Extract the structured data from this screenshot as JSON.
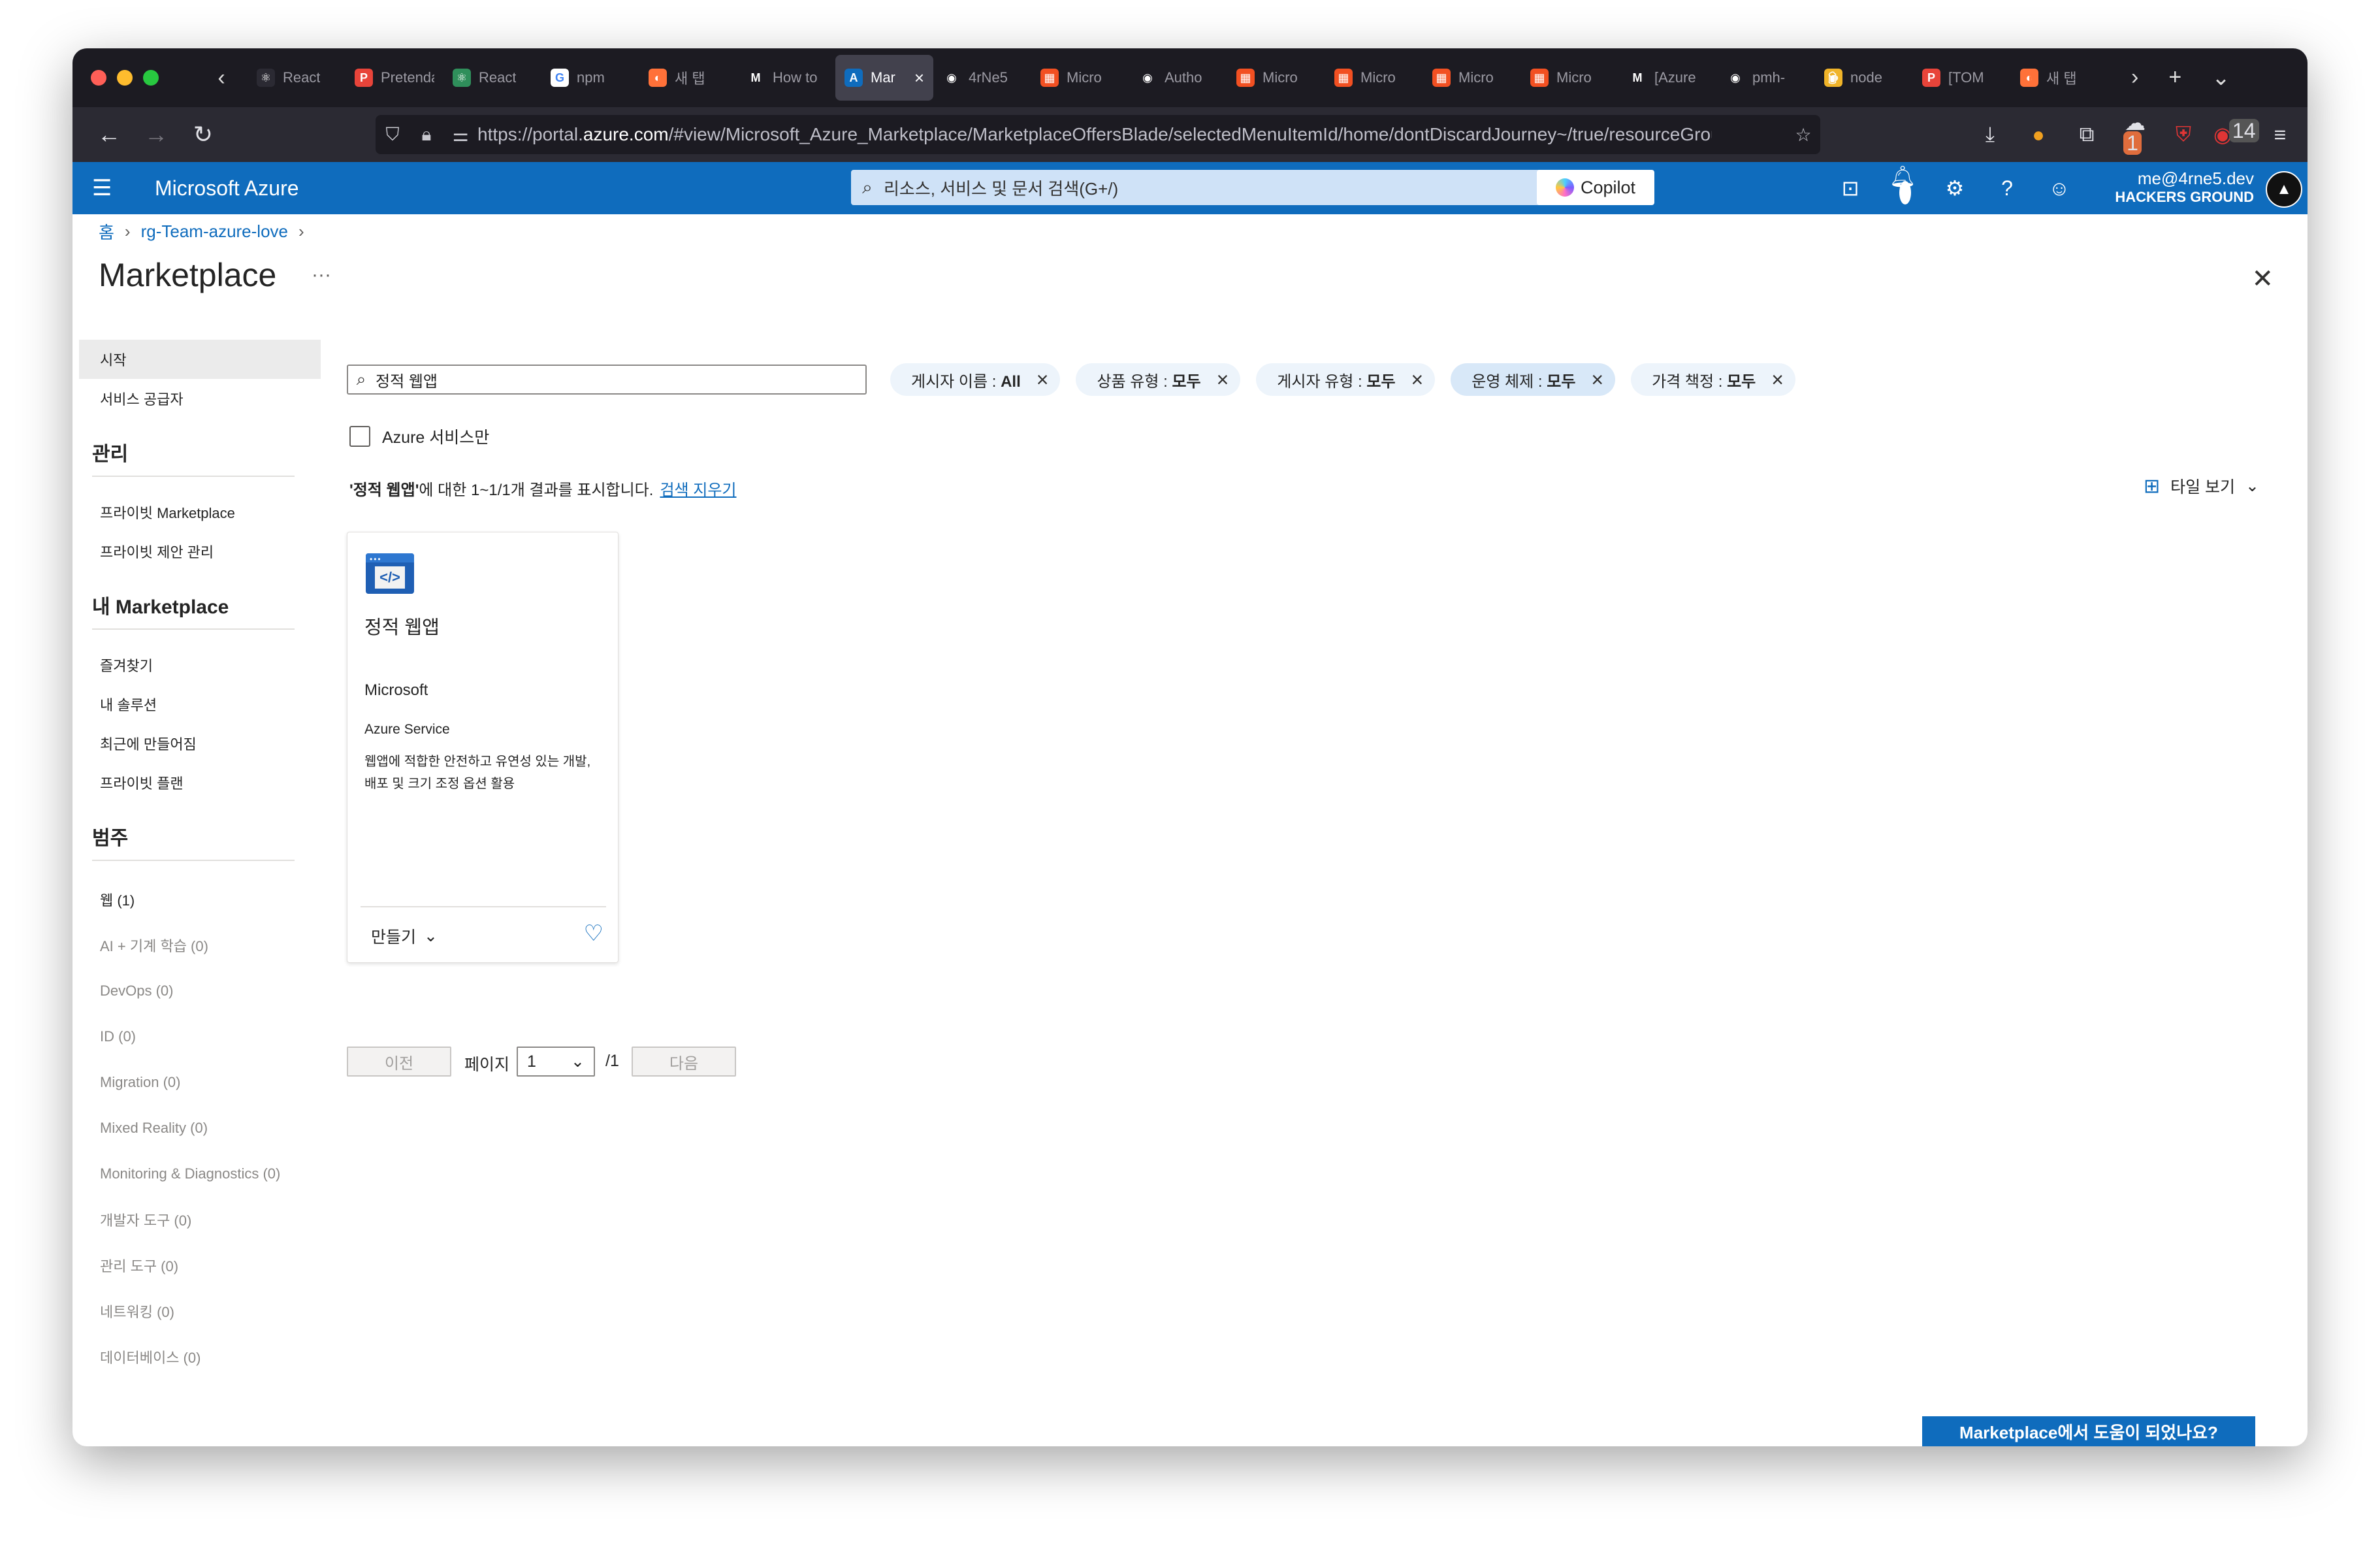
{
  "browser": {
    "tabs": [
      {
        "label": "React",
        "icon": "react-icon",
        "color": "#2b2a33"
      },
      {
        "label": "Pretendard",
        "icon": "pretendard-icon",
        "color": "#e8443a"
      },
      {
        "label": "React",
        "icon": "react-icon",
        "color": "#2f8f5b"
      },
      {
        "label": "npm",
        "icon": "google-icon",
        "color": "#ffffff"
      },
      {
        "label": "새 탭",
        "icon": "firefox-icon",
        "color": "#ff7139"
      },
      {
        "label": "How to",
        "icon": "medium-icon",
        "color": "#1c1b22"
      },
      {
        "label": "Mar",
        "icon": "azure-icon",
        "color": "#0f6cbd",
        "active": true
      },
      {
        "label": "4rNe5",
        "icon": "github-icon",
        "color": "#1c1b22"
      },
      {
        "label": "Micro",
        "icon": "microsoft-icon",
        "color": "#f25022"
      },
      {
        "label": "Autho",
        "icon": "github-icon",
        "color": "#1c1b22"
      },
      {
        "label": "Micro",
        "icon": "microsoft-icon",
        "color": "#f25022"
      },
      {
        "label": "Micro",
        "icon": "microsoft-icon",
        "color": "#f25022"
      },
      {
        "label": "Micro",
        "icon": "microsoft-icon",
        "color": "#f25022"
      },
      {
        "label": "Micro",
        "icon": "microsoft-icon",
        "color": "#f25022"
      },
      {
        "label": "[Azure",
        "icon": "medium-icon",
        "color": "#1c1b22"
      },
      {
        "label": "pmh-",
        "icon": "github-icon",
        "color": "#1c1b22"
      },
      {
        "label": "node",
        "icon": "beer-icon",
        "color": "#f0b429"
      },
      {
        "label": "[TOM",
        "icon": "pretendard-icon",
        "color": "#e8443a"
      },
      {
        "label": "새 탭",
        "icon": "firefox-icon",
        "color": "#ff7139"
      }
    ],
    "url_prefix": "https://portal.",
    "url_domain": "azure.com",
    "url_rest": "/#view/Microsoft_Azure_Marketplace/MarketplaceOffersBlade/selectedMenuItemId/home/dontDiscardJourney~/true/resourceGrou",
    "extension_badge": "1",
    "notif_badge": "14"
  },
  "azure": {
    "brand": "Microsoft Azure",
    "search_placeholder": "리소스, 서비스 및 문서 검색(G+/)",
    "copilot": "Copilot",
    "notification_count": "1",
    "user_email": "me@4rne5.dev",
    "user_org": "HACKERS GROUND"
  },
  "breadcrumb": [
    "홈",
    "rg-Team-azure-love"
  ],
  "page_title": "Marketplace",
  "more": "···",
  "sidebar": {
    "top_items": [
      "시작",
      "서비스 공급자"
    ],
    "manage_head": "관리",
    "manage_items": [
      "프라이빗 Marketplace",
      "프라이빗 제안 관리"
    ],
    "my_head": "내 Marketplace",
    "my_items": [
      "즐겨찾기",
      "내 솔루션",
      "최근에 만들어짐",
      "프라이빗 플랜"
    ],
    "category_head": "범주",
    "categories": [
      "웹 (1)",
      "AI + 기계 학습 (0)",
      "DevOps (0)",
      "ID (0)",
      "Migration (0)",
      "Mixed Reality (0)",
      "Monitoring & Diagnostics (0)",
      "개발자 도구 (0)",
      "관리 도구 (0)",
      "네트워킹 (0)",
      "데이터베이스 (0)"
    ]
  },
  "search": {
    "value": "정적 웹앱"
  },
  "filters": [
    {
      "label": "게시자 이름 : ",
      "value": "All"
    },
    {
      "label": "상품 유형 : ",
      "value": "모두"
    },
    {
      "label": "게시자 유형 : ",
      "value": "모두"
    },
    {
      "label": "운영 체제 : ",
      "value": "모두"
    },
    {
      "label": "가격 책정 : ",
      "value": "모두"
    }
  ],
  "azure_only": "Azure 서비스만",
  "results": {
    "query": "'정적 웹앱'",
    "text": "에 대한 1~1/1개 결과를 표시합니다.",
    "clear": "검색 지우기"
  },
  "view_toggle": "타일 보기",
  "card": {
    "title": "정적 웹앱",
    "publisher": "Microsoft",
    "type": "Azure Service",
    "description": "웹앱에 적합한 안전하고 유연성 있는 개발, 배포 및 크기 조정 옵션 활용",
    "create": "만들기"
  },
  "pagination": {
    "prev": "이전",
    "page_label": "페이지",
    "page": "1",
    "total": "/1",
    "next": "다음"
  },
  "feedback": "Marketplace에서 도움이 되었나요?"
}
